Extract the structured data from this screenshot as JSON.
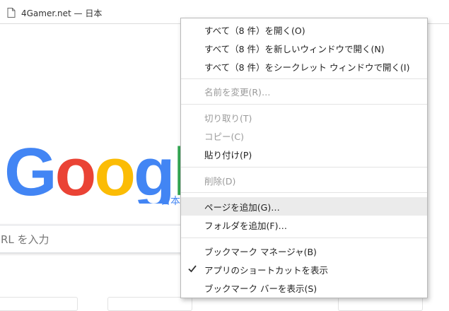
{
  "bookmarks_bar": {
    "items": [
      {
        "label": "4Gamer.net — 日本"
      }
    ]
  },
  "page": {
    "logo_text": "Google",
    "logo_sub": "日本",
    "search_placeholder": "RL を入力"
  },
  "context_menu": {
    "items": [
      {
        "label": "すべて（8 件）を開く(O)",
        "disabled": false
      },
      {
        "label": "すべて（8 件）を新しいウィンドウで開く(N)",
        "disabled": false
      },
      {
        "label": "すべて（8 件）をシークレット ウィンドウで開く(I)",
        "disabled": false
      },
      {
        "label": "名前を変更(R)…",
        "disabled": true
      },
      {
        "label": "切り取り(T)",
        "disabled": true
      },
      {
        "label": "コピー(C)",
        "disabled": true
      },
      {
        "label": "貼り付け(P)",
        "disabled": false
      },
      {
        "label": "削除(D)",
        "disabled": true
      },
      {
        "label": "ページを追加(G)…",
        "disabled": false,
        "highlighted": true
      },
      {
        "label": "フォルダを追加(F)…",
        "disabled": false
      },
      {
        "label": "ブックマーク マネージャ(B)",
        "disabled": false
      },
      {
        "label": "アプリのショートカットを表示",
        "disabled": false,
        "checked": true
      },
      {
        "label": "ブックマーク バーを表示(S)",
        "disabled": false
      }
    ]
  },
  "colors": {
    "google_blue": "#4285f4",
    "google_red": "#ea4335",
    "google_yellow": "#fbbc05",
    "google_green": "#34a853",
    "menu_highlight": "#ebebeb",
    "disabled_text": "#9a9a9a"
  }
}
